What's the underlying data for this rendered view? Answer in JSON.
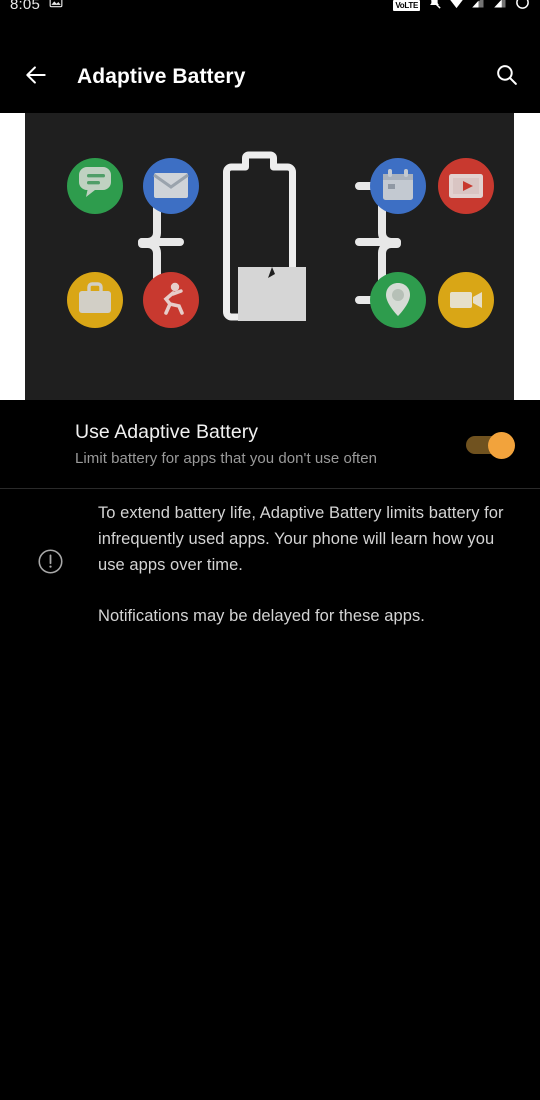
{
  "status_bar": {
    "time": "8:05",
    "left_icons": [
      "image-notification-icon"
    ],
    "right_icons": [
      "volte-icon",
      "mute-bell-icon",
      "wifi-icon",
      "signal-sim1-icon",
      "signal-sim2-icon",
      "battery-icon"
    ],
    "volte_label": "VoLTE"
  },
  "app_bar": {
    "back_icon": "back-arrow-icon",
    "title": "Adaptive Battery",
    "search_icon": "search-icon"
  },
  "illustration": {
    "name": "adaptive-battery-illustration",
    "background": "#1f1f1f",
    "battery": {
      "outline_color": "#e8e8e8",
      "fill_color": "#d6d6d6",
      "fill_level_percent": 40
    },
    "connector_color": "#e8e8e8",
    "app_icons": [
      {
        "name": "messages-app-icon",
        "glyph": "chat-bubble-icon",
        "color": "#2e9c4d",
        "side": "left",
        "row": "top"
      },
      {
        "name": "email-app-icon",
        "glyph": "envelope-icon",
        "color": "#3d6fc4",
        "side": "left",
        "row": "top"
      },
      {
        "name": "work-app-icon",
        "glyph": "briefcase-icon",
        "color": "#d9a616",
        "side": "left",
        "row": "bottom"
      },
      {
        "name": "fitness-app-icon",
        "glyph": "running-person-icon",
        "color": "#c8392f",
        "side": "left",
        "row": "bottom"
      },
      {
        "name": "calendar-app-icon",
        "glyph": "calendar-icon",
        "color": "#3d6fc4",
        "side": "right",
        "row": "top"
      },
      {
        "name": "video-app-icon",
        "glyph": "play-window-icon",
        "color": "#c8392f",
        "side": "right",
        "row": "top"
      },
      {
        "name": "maps-app-icon",
        "glyph": "map-pin-icon",
        "color": "#2e9c4d",
        "side": "right",
        "row": "bottom"
      },
      {
        "name": "camera-app-icon",
        "glyph": "video-camera-icon",
        "color": "#d9a616",
        "side": "right",
        "row": "bottom"
      }
    ]
  },
  "setting": {
    "title": "Use Adaptive Battery",
    "subtitle": "Limit battery for apps that you don't use often",
    "toggle_state": "on",
    "toggle_accent": "#f2a33c",
    "toggle_track": "#70521f"
  },
  "description": {
    "info_icon": "info-circle-icon",
    "paragraph_1": "To extend battery life, Adaptive Battery limits battery for infrequently used apps. Your phone will learn how you use apps over time.",
    "paragraph_2": "Notifications may be delayed for these apps."
  }
}
